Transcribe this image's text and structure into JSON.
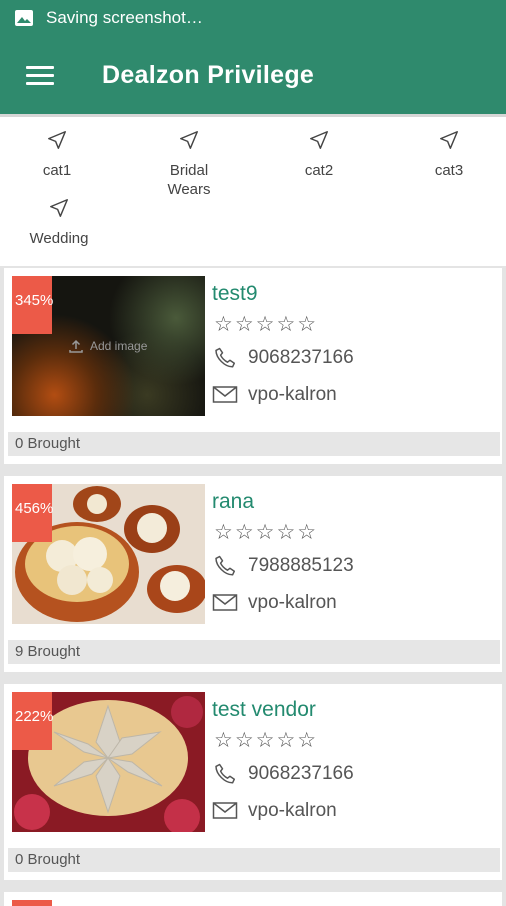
{
  "status_bar": {
    "text": "Saving screenshot…",
    "icon": "image-icon"
  },
  "app_bar": {
    "title": "Dealzon Privilege",
    "menu_icon": "menu-icon"
  },
  "categories": [
    {
      "label": "cat1",
      "icon": "navigation-arrow-icon"
    },
    {
      "label": "Bridal\nWears",
      "icon": "navigation-arrow-icon"
    },
    {
      "label": "cat2",
      "icon": "navigation-arrow-icon"
    },
    {
      "label": "cat3",
      "icon": "navigation-arrow-icon"
    },
    {
      "label": "Wedding",
      "icon": "navigation-arrow-icon"
    }
  ],
  "vendors": [
    {
      "name": "test9",
      "discount": "345%",
      "rating": 0,
      "phone": "9068237166",
      "address": "vpo-kalron",
      "brought": "0 Brought",
      "image_placeholder": "Add image"
    },
    {
      "name": "rana",
      "discount": "456%",
      "rating": 0,
      "phone": "7988885123",
      "address": "vpo-kalron",
      "brought": "9 Brought"
    },
    {
      "name": "test vendor",
      "discount": "222%",
      "rating": 0,
      "phone": "9068237166",
      "address": "vpo-kalron",
      "brought": "0 Brought"
    }
  ],
  "colors": {
    "primary": "#2f8a6d",
    "vendor_name": "#238a6f",
    "badge": "#ec5a48"
  }
}
